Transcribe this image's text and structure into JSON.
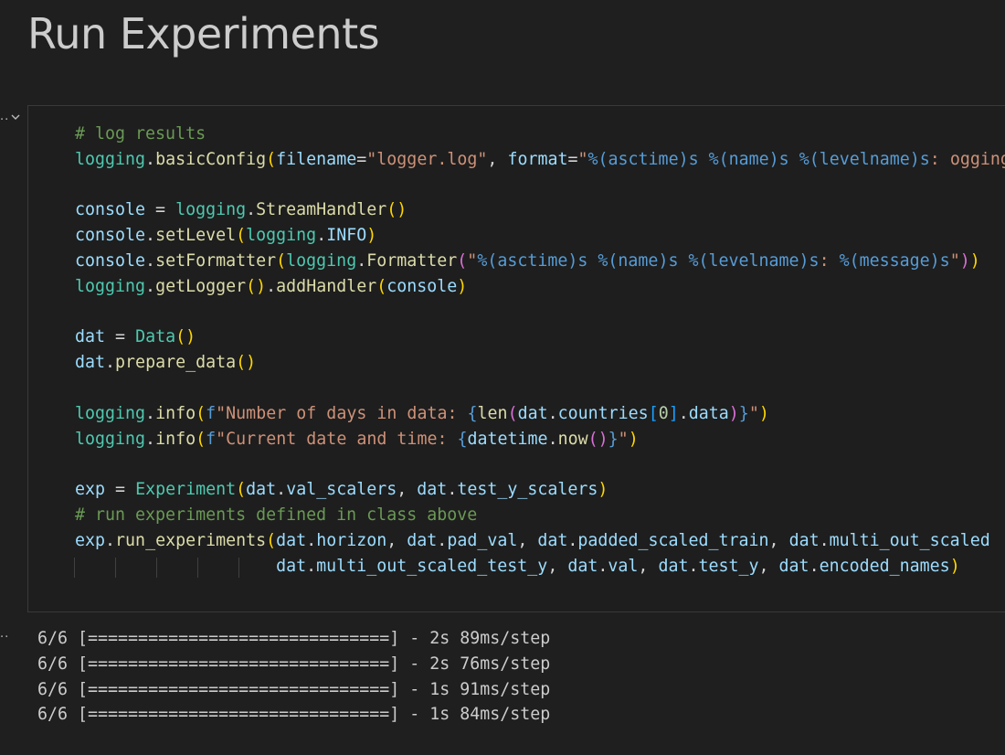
{
  "heading": "Run Experiments",
  "cell": {
    "gutter_dots": "..",
    "toolbar_icon": "chevron-down-icon",
    "code_lines": [
      "# log results",
      "logging.basicConfig(filename=\"logger.log\", format=\"%(asctime)s %(name)s %(levelname)s: %(me",
      "",
      "console = logging.StreamHandler()",
      "console.setLevel(logging.INFO)",
      "console.setFormatter(logging.Formatter(\"%(asctime)s %(name)s %(levelname)s: %(message)s\"))",
      "logging.getLogger().addHandler(console)",
      "",
      "dat = Data()",
      "dat.prepare_data()",
      "",
      "logging.info(f\"Number of days in data: {len(dat.countries[0].data)}\")",
      "logging.info(f\"Current date and time: {datetime.now()}\")",
      "",
      "exp = Experiment(dat.val_scalers, dat.test_y_scalers)",
      "# run experiments defined in class above",
      "exp.run_experiments(dat.horizon, dat.pad_val, dat.padded_scaled_train, dat.multi_out_scaled",
      "                    dat.multi_out_scaled_test_y, dat.val, dat.test_y, dat.encoded_names)"
    ]
  },
  "output": {
    "gutter_dots": "..",
    "lines": [
      "6/6 [==============================] - 2s 89ms/step",
      "6/6 [==============================] - 2s 76ms/step",
      "6/6 [==============================] - 1s 91ms/step",
      "6/6 [==============================] - 1s 84ms/step"
    ]
  },
  "colors": {
    "background": "#1f1f1f",
    "comment": "#6a9955",
    "variable": "#9cdcfe",
    "function": "#dcdcaa",
    "class": "#4ec9b0",
    "string": "#ce9178",
    "escape": "#569cd6",
    "bracket_level_1": "#ffd700",
    "bracket_level_2": "#da70d6",
    "bracket_level_3": "#179fff"
  }
}
